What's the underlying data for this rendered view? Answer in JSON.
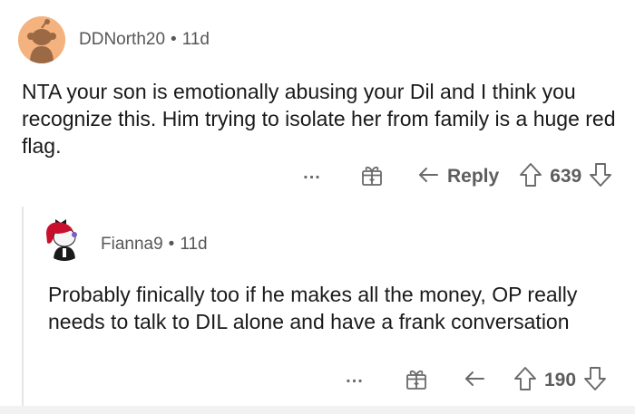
{
  "comments": [
    {
      "username": "DDNorth20",
      "separator": "•",
      "age": "11d",
      "text": "NTA your son is emotionally abusing your Dil and I think you recognize this. Him trying to isolate her from family is a huge red flag.",
      "more_label": "...",
      "reply_label": "Reply",
      "score": "639",
      "icons": {
        "avatar": "snoo-avatar-icon",
        "award": "gift-award-icon",
        "reply": "reply-arrow-icon",
        "upvote": "upvote-arrow-icon",
        "downvote": "downvote-arrow-icon"
      }
    },
    {
      "username": "Fianna9",
      "separator": "•",
      "age": "11d",
      "text": "Probably finically too if he makes all the money, OP really needs to talk to DIL alone and have a frank conversation",
      "more_label": "...",
      "score": "190",
      "icons": {
        "avatar": "red-hair-snoo-avatar-icon",
        "award": "gift-award-icon",
        "reply": "reply-arrow-icon",
        "upvote": "upvote-arrow-icon",
        "downvote": "downvote-arrow-icon"
      }
    }
  ],
  "colors": {
    "avatar_bg": "#f4b27f",
    "hair": "#c8102e",
    "text": "#1a1a1b",
    "meta": "#575757",
    "icon": "#6a6a6a"
  }
}
